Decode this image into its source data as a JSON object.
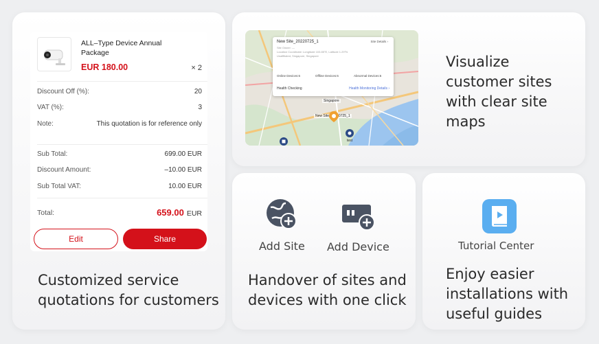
{
  "quote": {
    "product_name": "ALL–Type Device Annual Package",
    "price": "EUR  180.00",
    "quantity": "× 2",
    "discount_off_label": "Discount Off  (%):",
    "discount_off_value": "20",
    "vat_label": "VAT  (%):",
    "vat_value": "3",
    "note_label": "Note:",
    "note_value": "This quotation is for reference only",
    "sub_total_label": "Sub Total:",
    "sub_total_value": "699.00 EUR",
    "discount_amount_label": "Discount Amount:",
    "discount_amount_value": "–10.00 EUR",
    "sub_total_vat_label": "Sub Total VAT:",
    "sub_total_vat_value": "10.00 EUR",
    "total_label": "Total:",
    "total_value": "659.00",
    "total_currency": "EUR",
    "edit_label": "Edit",
    "share_label": "Share",
    "caption": "Customized service quotations for customers",
    "accent_color": "#d4111a"
  },
  "map": {
    "popup_title": "New Site_20220725_1",
    "popup_link": "Site Details  ›",
    "popup_line1": "Site Owner: —",
    "popup_line2": "Location Coordinate: Longitude 103.85°E, Latitude 1.29°N",
    "popup_line3": "Unaffiliated, Singapore, Singapore",
    "popup_online": "Online Devices:6",
    "popup_offline": "Offline Devices:6",
    "popup_abnormal": "Abnormal Devices:6",
    "popup_health": "Health Checking",
    "popup_health_link": "Health Monitoring Details  ›",
    "label_city": "Singapore",
    "label_site": "New Site_20220725_1",
    "label_test": "test",
    "caption": "Visualize customer sites with clear site maps"
  },
  "handover": {
    "add_site_label": "Add Site",
    "add_device_label": "Add Device",
    "caption": "Handover of sites and devices with one click",
    "icon_color": "#4a5363"
  },
  "tutorial": {
    "label": "Tutorial Center",
    "caption": "Enjoy easier installations with useful guides",
    "icon_color": "#5aaef0"
  }
}
